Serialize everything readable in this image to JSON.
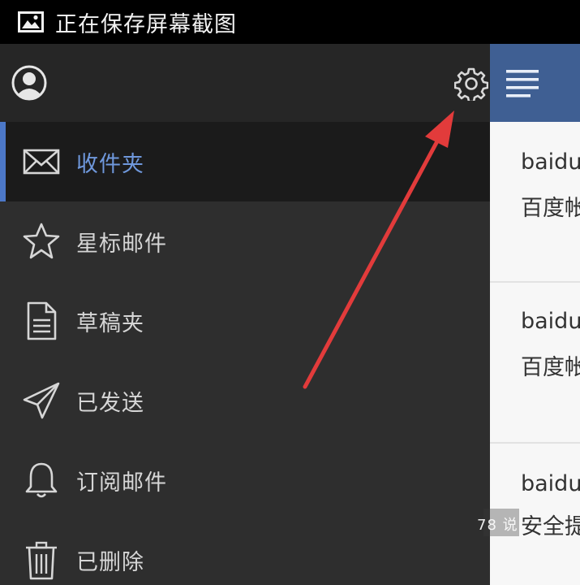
{
  "status_bar": {
    "text": "正在保存屏幕截图",
    "icon": "image-icon"
  },
  "drawer": {
    "header": {
      "avatar_icon": "user-avatar-icon",
      "settings_icon": "gear-icon"
    },
    "menu": [
      {
        "label": "收件夹",
        "icon": "envelope-icon",
        "active": true
      },
      {
        "label": "星标邮件",
        "icon": "star-icon",
        "active": false
      },
      {
        "label": "草稿夹",
        "icon": "document-icon",
        "active": false
      },
      {
        "label": "已发送",
        "icon": "paper-plane-icon",
        "active": false
      },
      {
        "label": "订阅邮件",
        "icon": "bell-icon",
        "active": false
      },
      {
        "label": "已删除",
        "icon": "trash-icon",
        "active": false
      }
    ]
  },
  "main": {
    "menu_icon": "hamburger-icon",
    "mails": [
      {
        "sender": "baidu",
        "subject": "百度帐"
      },
      {
        "sender": "baidu",
        "subject": "百度帐"
      },
      {
        "sender": "baidu",
        "subject": "安全提"
      }
    ]
  },
  "watermark": {
    "text": "78 说"
  },
  "colors": {
    "status_bar": "#000000",
    "drawer_bg": "#2e2e2e",
    "drawer_header": "#262626",
    "active_item_bg": "#1b1b1b",
    "active_accent": "#4c78c8",
    "active_label": "#6f98dc",
    "main_header": "#3f5f93",
    "annotation_arrow": "#e23b3b"
  }
}
